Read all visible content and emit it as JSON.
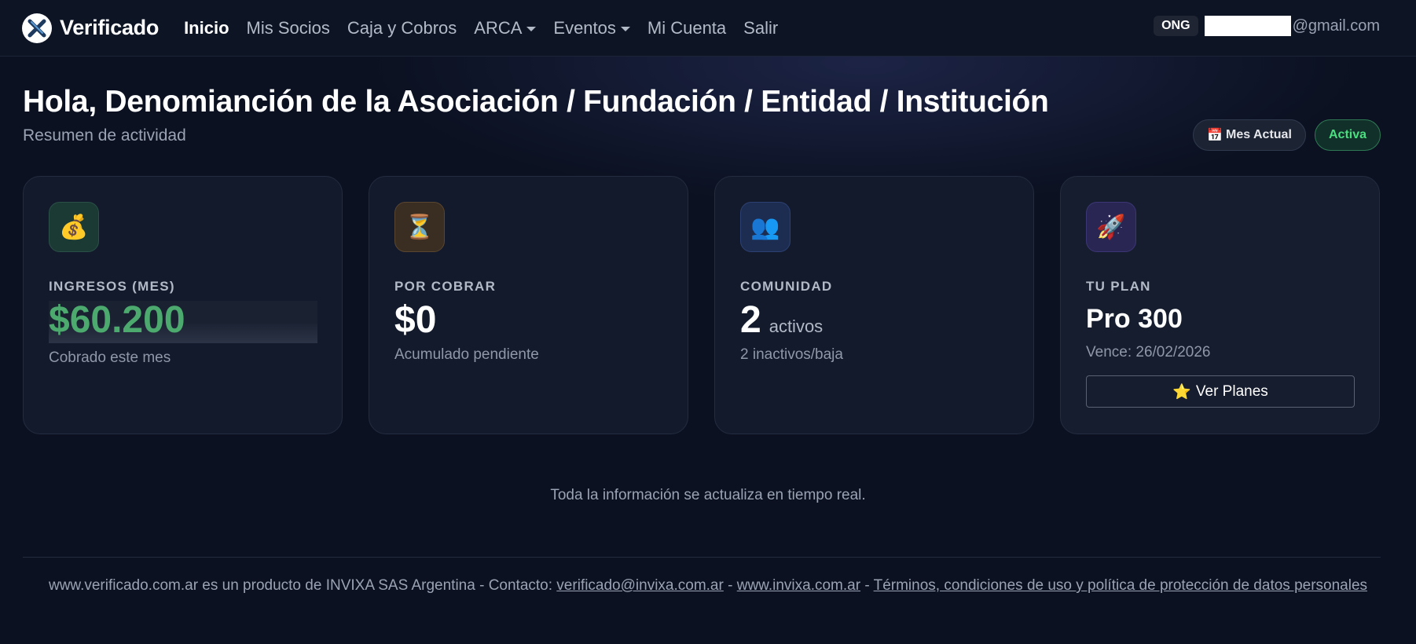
{
  "brand": {
    "name": "Verificado",
    "logo_icon": "verificado-x-logo"
  },
  "nav": {
    "items": [
      {
        "label": "Inicio",
        "active": true,
        "dropdown": false
      },
      {
        "label": "Mis Socios",
        "active": false,
        "dropdown": false
      },
      {
        "label": "Caja y Cobros",
        "active": false,
        "dropdown": false
      },
      {
        "label": "ARCA",
        "active": false,
        "dropdown": true
      },
      {
        "label": "Eventos",
        "active": false,
        "dropdown": true
      },
      {
        "label": "Mi Cuenta",
        "active": false,
        "dropdown": false
      },
      {
        "label": "Salir",
        "active": false,
        "dropdown": false
      }
    ],
    "account_type": "ONG",
    "email_domain": "@gmail.com"
  },
  "header": {
    "title": "Hola, Denomianción de la Asociación / Fundación / Entidad / Institución",
    "subtitle": "Resumen de actividad",
    "period_icon": "📅",
    "period_label": "Mes Actual",
    "status_label": "Activa"
  },
  "cards": {
    "income": {
      "icon": "💰",
      "label": "INGRESOS (MES)",
      "value": "$60.200",
      "note": "Cobrado este mes"
    },
    "pending": {
      "icon": "⏳",
      "label": "POR COBRAR",
      "value": "$0",
      "note": "Acumulado pendiente"
    },
    "community": {
      "icon": "👥",
      "label": "COMUNIDAD",
      "value": "2",
      "unit": "activos",
      "note": "2 inactivos/baja"
    },
    "plan": {
      "icon": "🚀",
      "label": "TU PLAN",
      "name": "Pro 300",
      "expiry": "Vence: 26/02/2026",
      "button_icon": "⭐",
      "button_label": "Ver Planes"
    }
  },
  "realtime_note": "Toda la información se actualiza en tiempo real.",
  "footer": {
    "text_prefix": "www.verificado.com.ar es un producto de INVIXA SAS Argentina - Contacto: ",
    "email_link": "verificado@invixa.com.ar",
    "sep1": " - ",
    "site_link": "www.invixa.com.ar",
    "sep2": " - ",
    "terms_link": "Términos, condiciones de uso y política de protección de datos personales"
  },
  "colors": {
    "accent_green": "#4caa6e",
    "active_green": "#4ade80",
    "background": "#0b1120"
  }
}
